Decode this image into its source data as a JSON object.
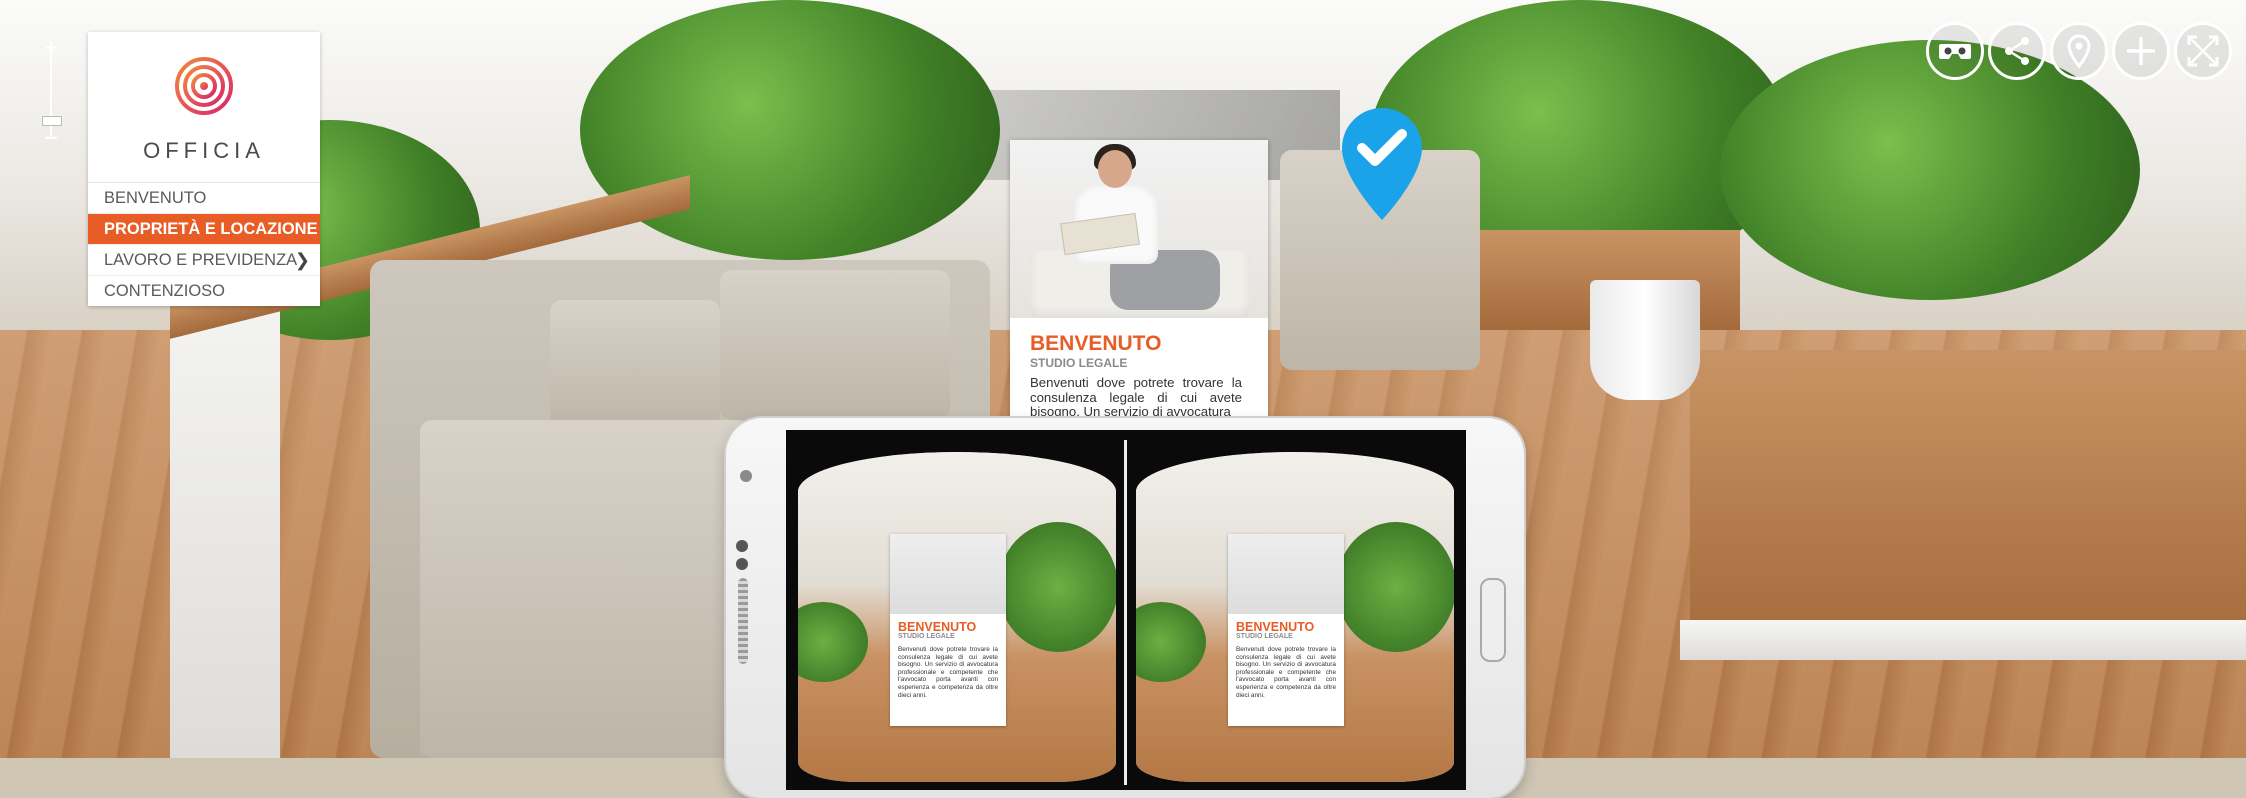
{
  "zoom": {
    "in_label": "+",
    "out_label": "−"
  },
  "brand": {
    "name": "OFFICIA",
    "accent": "#e85d26"
  },
  "menu": {
    "items": [
      {
        "label": "BENVENUTO",
        "active": false
      },
      {
        "label": "PROPRIETÀ E LOCAZIONE",
        "active": true
      },
      {
        "label": "LAVORO E PREVIDENZA",
        "active": false,
        "submenu_icon": "chevron-right-icon"
      },
      {
        "label": "CONTENZIOSO",
        "active": false
      }
    ]
  },
  "toolbar": {
    "icons": [
      "vr-headset-icon",
      "share-icon",
      "map-pin-icon",
      "zoom-in-icon",
      "fullscreen-icon"
    ]
  },
  "hotspot": {
    "icon": "check-pin-icon",
    "color": "#1aa3e8"
  },
  "card": {
    "title": "BENVENUTO",
    "subtitle": "STUDIO LEGALE",
    "body": "Benvenuti dove potrete trovare la consulenza legale di cui avete bisogno. Un servizio di avvocatura"
  },
  "vr_preview": {
    "title": "BENVENUTO",
    "subtitle": "STUDIO LEGALE",
    "body": "Benvenuti dove potrete trovare la consulenza legale di cui avete bisogno. Un servizio di avvocatura professionale e competente che l'avvocato porta avanti con esperienza e competenza da oltre dieci anni."
  }
}
